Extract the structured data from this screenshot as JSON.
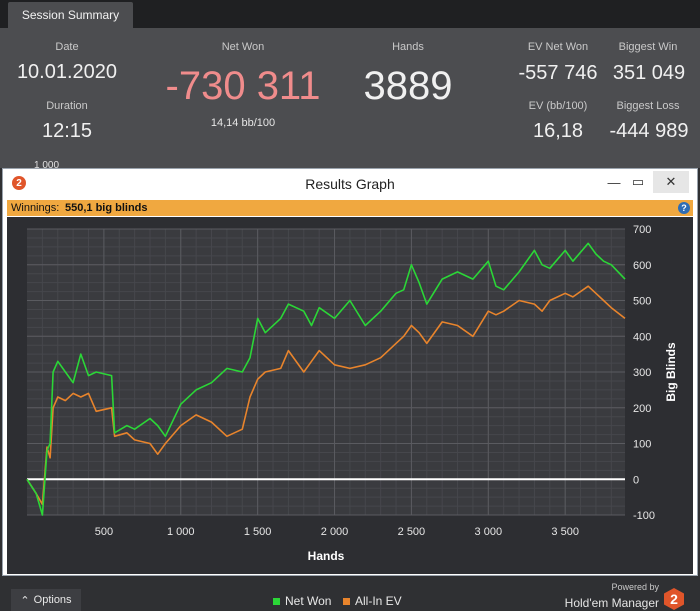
{
  "session_tab": "Session Summary",
  "summary": {
    "date_label": "Date",
    "date": "10.01.2020",
    "duration_label": "Duration",
    "duration": "12:15",
    "net_won_label": "Net Won",
    "net_won": "-730 311",
    "bb_per_100": "14,14 bb/100",
    "hands_label": "Hands",
    "hands": "3889",
    "ev_net_won_label": "EV Net Won",
    "ev_net_won": "-557 746",
    "ev_bb_label": "EV (bb/100)",
    "ev_bb": "16,18",
    "biggest_win_label": "Biggest Win",
    "biggest_win": "351 049",
    "biggest_loss_label": "Biggest Loss",
    "biggest_loss": "-444 989",
    "cut_text": "1 000",
    "net_won_color": "#f08c8c"
  },
  "window": {
    "title": "Results Graph",
    "badge": "2",
    "minimize_icon": "—",
    "maximize_icon": "▭",
    "close_icon": "✕",
    "winnings_label": "Winnings:",
    "winnings_value": "550,1 big blinds",
    "help_icon": "?",
    "options_label": "Options",
    "options_icon": "⌃",
    "powered_by": "Powered by",
    "brand": "Hold'em Manager",
    "brand_digit": "2"
  },
  "chart_data": {
    "type": "line",
    "xlabel": "Hands",
    "ylabel": "Big Blinds",
    "xlim": [
      0,
      3889
    ],
    "ylim": [
      -100,
      700
    ],
    "x_ticks": [
      500,
      1000,
      1500,
      2000,
      2500,
      3000,
      3500
    ],
    "x_tick_labels": [
      "500",
      "1 000",
      "1 500",
      "2 000",
      "2 500",
      "3 000",
      "3 500"
    ],
    "y_ticks": [
      700,
      600,
      500,
      400,
      300,
      200,
      100,
      0,
      -100
    ],
    "y_tick_labels": [
      "700",
      "600",
      "500",
      "400",
      "300",
      "200",
      "100",
      "0",
      "-100"
    ],
    "grid": true,
    "legend_position": "bottom",
    "series": [
      {
        "name": "Net Won",
        "color": "#2bd637",
        "x": [
          0,
          60,
          100,
          130,
          150,
          170,
          200,
          250,
          300,
          350,
          400,
          450,
          550,
          570,
          650,
          700,
          800,
          850,
          900,
          1000,
          1100,
          1200,
          1300,
          1400,
          1450,
          1500,
          1550,
          1650,
          1700,
          1800,
          1850,
          1900,
          2000,
          2100,
          2200,
          2300,
          2400,
          2450,
          2500,
          2550,
          2600,
          2700,
          2800,
          2900,
          3000,
          3050,
          3100,
          3200,
          3300,
          3350,
          3400,
          3500,
          3550,
          3650,
          3700,
          3750,
          3800,
          3889
        ],
        "y": [
          0,
          -40,
          -100,
          80,
          100,
          300,
          330,
          300,
          270,
          350,
          290,
          300,
          290,
          130,
          150,
          140,
          170,
          150,
          120,
          210,
          250,
          270,
          310,
          300,
          340,
          450,
          410,
          450,
          490,
          470,
          430,
          480,
          450,
          500,
          430,
          470,
          520,
          530,
          600,
          550,
          490,
          560,
          580,
          560,
          610,
          540,
          530,
          580,
          640,
          600,
          590,
          640,
          610,
          660,
          630,
          610,
          600,
          560
        ]
      },
      {
        "name": "All-In EV",
        "color": "#e8842c",
        "x": [
          0,
          60,
          100,
          130,
          150,
          170,
          200,
          250,
          300,
          350,
          400,
          450,
          550,
          570,
          650,
          700,
          800,
          850,
          900,
          1000,
          1100,
          1200,
          1300,
          1400,
          1450,
          1500,
          1550,
          1650,
          1700,
          1800,
          1850,
          1900,
          2000,
          2100,
          2200,
          2300,
          2400,
          2450,
          2500,
          2550,
          2600,
          2700,
          2800,
          2900,
          3000,
          3050,
          3100,
          3200,
          3300,
          3350,
          3400,
          3500,
          3550,
          3650,
          3700,
          3750,
          3800,
          3889
        ],
        "y": [
          0,
          -40,
          -70,
          90,
          60,
          200,
          230,
          220,
          240,
          230,
          240,
          190,
          200,
          120,
          130,
          110,
          100,
          70,
          100,
          150,
          180,
          160,
          120,
          140,
          230,
          280,
          300,
          310,
          360,
          300,
          330,
          360,
          320,
          310,
          320,
          340,
          380,
          400,
          430,
          410,
          380,
          440,
          430,
          400,
          470,
          460,
          470,
          500,
          490,
          470,
          500,
          520,
          510,
          540,
          520,
          500,
          480,
          450
        ]
      }
    ]
  }
}
